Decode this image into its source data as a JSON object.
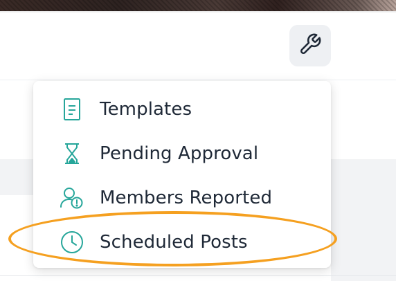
{
  "colors": {
    "accent": "#26a69a",
    "highlight": "#f5a020",
    "text": "#1f2937"
  },
  "header": {
    "tools_icon": "wrench-icon"
  },
  "menu": {
    "items": [
      {
        "label": "Templates",
        "icon": "document-icon"
      },
      {
        "label": "Pending Approval",
        "icon": "hourglass-icon"
      },
      {
        "label": "Members Reported",
        "icon": "member-alert-icon"
      },
      {
        "label": "Scheduled Posts",
        "icon": "clock-icon",
        "highlighted": true
      }
    ]
  }
}
